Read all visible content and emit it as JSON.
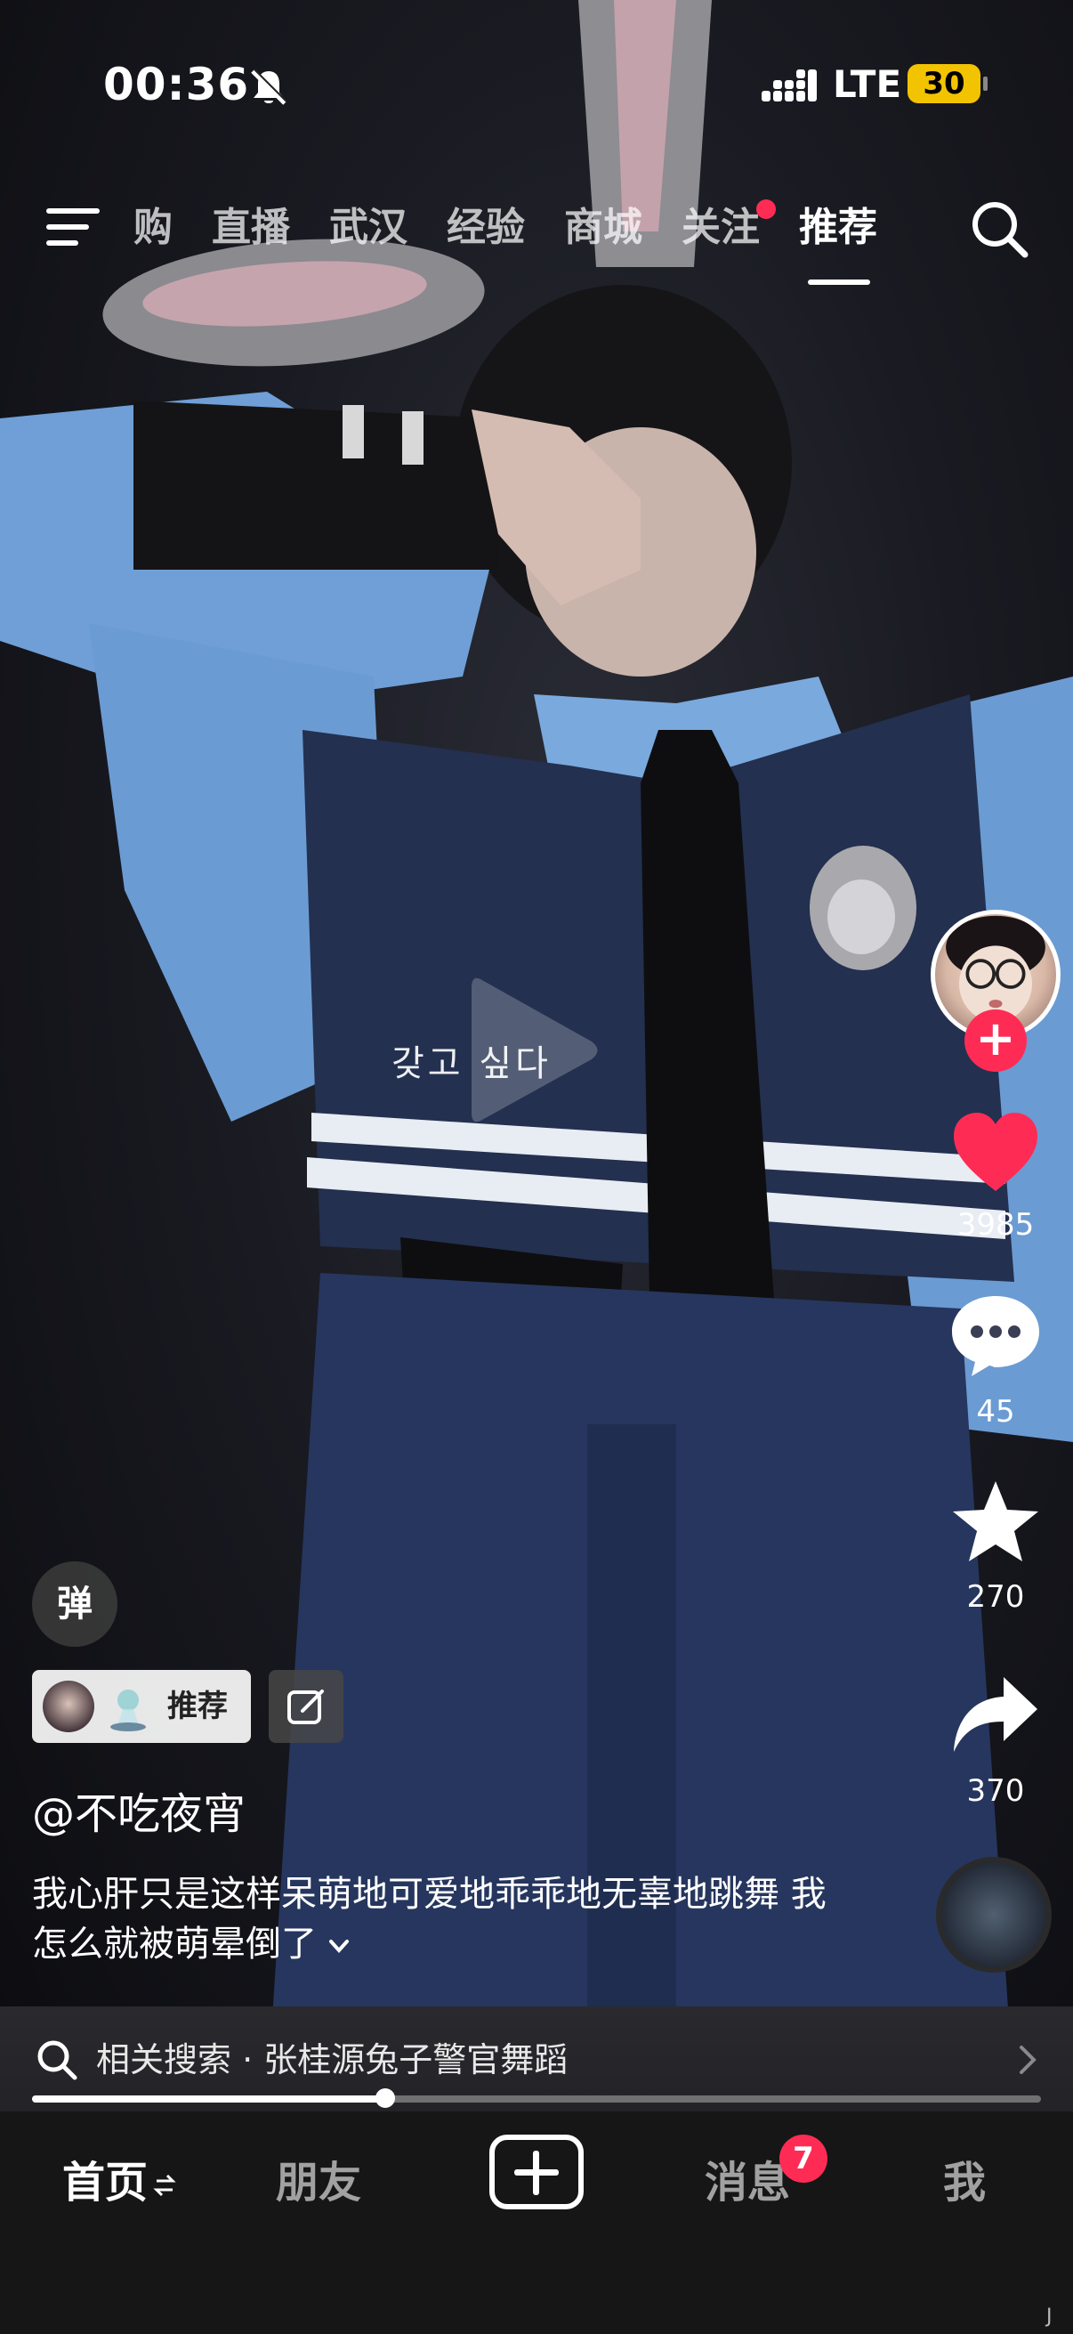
{
  "status_bar": {
    "time": "00:36",
    "network": "LTE",
    "battery": "30"
  },
  "top_nav": {
    "tabs": [
      {
        "label": "购",
        "active": false
      },
      {
        "label": "直播",
        "active": false
      },
      {
        "label": "武汉",
        "active": false
      },
      {
        "label": "经验",
        "active": false
      },
      {
        "label": "商城",
        "active": false
      },
      {
        "label": "关注",
        "active": false,
        "dot": true
      },
      {
        "label": "推荐",
        "active": true
      }
    ]
  },
  "video": {
    "lyric": "갖고 싶다"
  },
  "sidebar": {
    "like_count": "3985",
    "comment_count": "45",
    "favorite_count": "270",
    "share_count": "370",
    "follow_symbol": "+"
  },
  "info": {
    "danmu_label": "弹",
    "tag_label": "推荐",
    "author": "@不吃夜宵",
    "caption": "我心肝只是这样呆萌地可爱地乖乖地无辜地跳舞 我怎么就被萌晕倒了"
  },
  "related_search": {
    "text": "相关搜索 · 张桂源兔子警官舞蹈"
  },
  "progress": {
    "fraction": 0.35
  },
  "tabbar": {
    "home": "首页",
    "friends": "朋友",
    "messages": "消息",
    "messages_badge": "7",
    "me": "我"
  },
  "corner_mark": "J",
  "colors": {
    "accent": "#fe2c55",
    "battery": "#f2c300"
  },
  "icons": [
    "bell-slash-icon",
    "signal-icon",
    "menu-icon",
    "search-icon",
    "play-icon",
    "heart-icon",
    "comment-icon",
    "star-icon",
    "share-icon",
    "edit-icon",
    "chevron-down-icon",
    "chevron-right-icon",
    "plus-icon",
    "switch-icon"
  ]
}
